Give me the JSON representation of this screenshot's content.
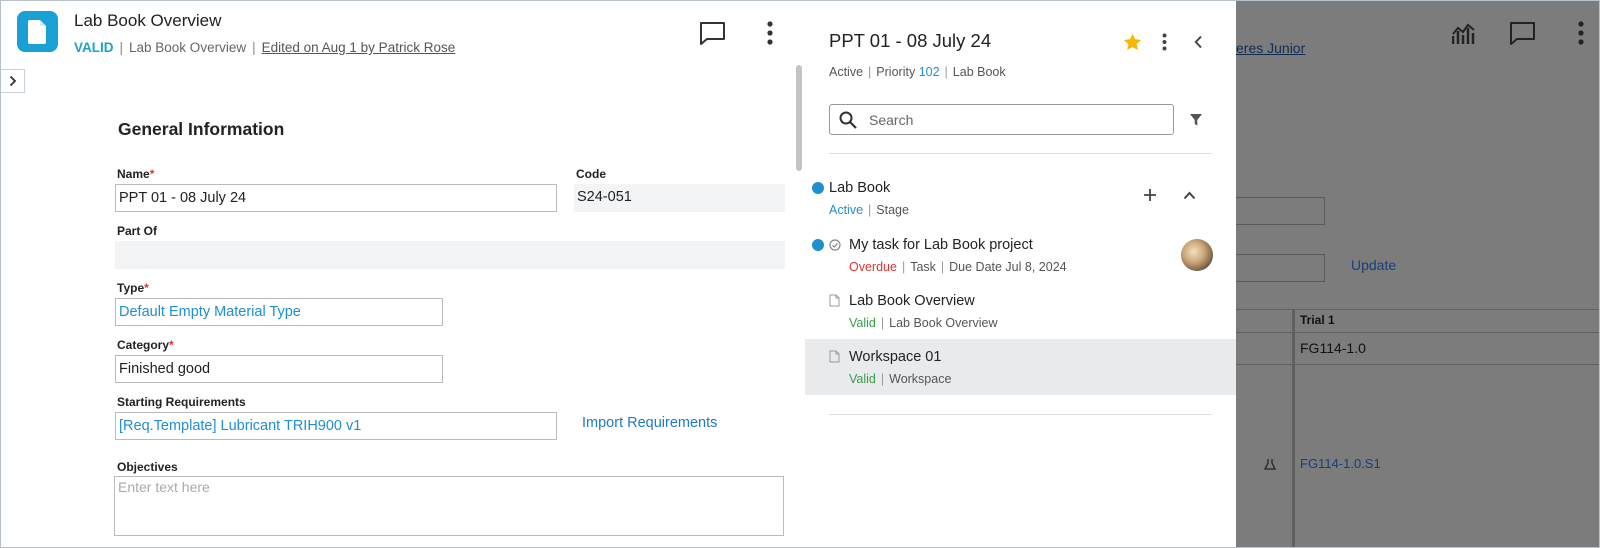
{
  "document": {
    "title": "Lab Book Overview",
    "status": "VALID",
    "breadcrumb": "Lab Book Overview",
    "edited": "Edited on Aug 1 by Patrick Rose"
  },
  "form": {
    "section_title": "General Information",
    "name_label": "Name",
    "name_value": "PPT 01 - 08 July 24",
    "code_label": "Code",
    "code_value": "S24-051",
    "partof_label": "Part Of",
    "type_label": "Type",
    "type_value": "Default Empty Material Type",
    "category_label": "Category",
    "category_value": "Finished good",
    "starting_req_label": "Starting Requirements",
    "starting_req_value": "[Req.Template] Lubricant TRIH900 v1",
    "import_label": "Import Requirements",
    "objectives_label": "Objectives",
    "objectives_placeholder": "Enter text here",
    "required_mark": "*"
  },
  "panel": {
    "title": "PPT 01 - 08 July 24",
    "status": "Active",
    "priority_label": "Priority",
    "priority_value": "102",
    "kind": "Lab Book",
    "search_placeholder": "Search",
    "star_color": "#f5b800",
    "items": [
      {
        "title": "Lab Book",
        "status": "Active",
        "type": "Stage"
      },
      {
        "title": "My task for Lab Book project",
        "status": "Overdue",
        "type": "Task",
        "due": "Due Date Jul 8, 2024"
      },
      {
        "title": "Lab Book Overview",
        "status": "Valid",
        "type": "Lab Book Overview"
      },
      {
        "title": "Workspace 01",
        "status": "Valid",
        "type": "Workspace"
      }
    ]
  },
  "background": {
    "author_fragment": "eres Junior",
    "update_label": "Update",
    "column_header": "Trial 1",
    "cell_1": "FG114-1.0",
    "cell_2": "FG114-1.0.S1"
  }
}
